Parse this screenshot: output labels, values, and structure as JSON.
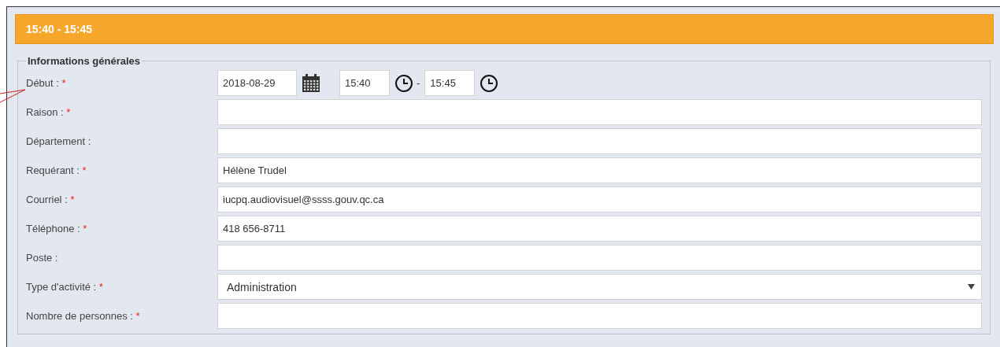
{
  "header": {
    "title": "15:40 - 15:45"
  },
  "section": {
    "legend": "Informations générales",
    "fields": [
      {
        "kind": "datetime",
        "label": "Début :",
        "required_mark": "*",
        "date": "2018-08-29",
        "start": "15:40",
        "separator": "-",
        "end": "15:45"
      },
      {
        "kind": "text",
        "label": "Raison :",
        "required_mark": "*"
      },
      {
        "kind": "text",
        "label": "Département :"
      },
      {
        "kind": "text",
        "label": "Requérant :",
        "required_mark": "*",
        "value": "Hélène Trudel"
      },
      {
        "kind": "text",
        "label": "Courriel :",
        "required_mark": "*",
        "value": "iucpq.audiovisuel@ssss.gouv.qc.ca"
      },
      {
        "kind": "text",
        "label": "Téléphone :",
        "required_mark": "*",
        "value": "418 656-8711"
      },
      {
        "kind": "text",
        "label": "Poste :"
      },
      {
        "kind": "select",
        "label": "Type d'activité :",
        "required_mark": "*",
        "value": "Administration"
      },
      {
        "kind": "text",
        "label": "Nombre de personnes :",
        "required_mark": "*"
      }
    ]
  }
}
